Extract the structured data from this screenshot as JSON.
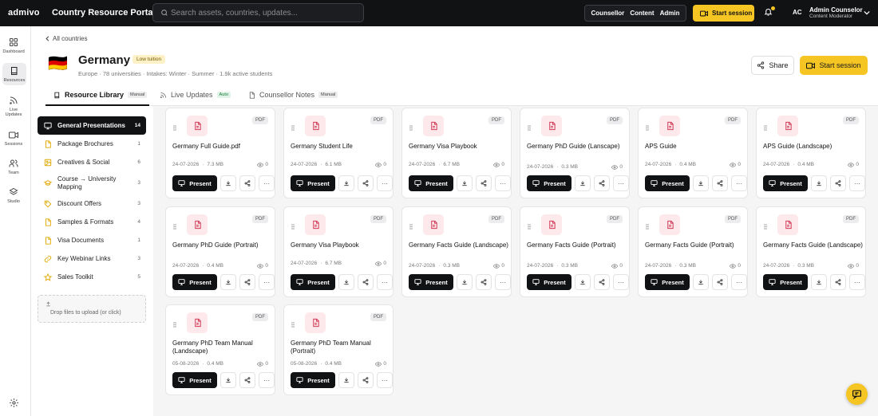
{
  "app": {
    "brand": "admivo",
    "title": "Country Resource Portal"
  },
  "search": {
    "placeholder": "Search assets, countries, updates..."
  },
  "roles": [
    "Counsellor",
    "Content",
    "Admin"
  ],
  "header": {
    "start_session": "Start session"
  },
  "user": {
    "initials": "AC",
    "name": "Admin Counselor",
    "role": "Content Moderator"
  },
  "rail": [
    {
      "label": "Dashboard",
      "icon": "grid-icon"
    },
    {
      "label": "Resources",
      "icon": "book-icon"
    },
    {
      "label": "Live Updates",
      "icon": "rss-icon"
    },
    {
      "label": "Sessions",
      "icon": "video-icon"
    },
    {
      "label": "Team",
      "icon": "users-icon"
    },
    {
      "label": "Studio",
      "icon": "layers-icon"
    }
  ],
  "page": {
    "back": "All countries",
    "flag": "🇩🇪",
    "country": "Germany",
    "badge": "Low tuition",
    "meta": "Europe · 78 universities · Intakes: Winter · Summer · 1.9k active students",
    "share": "Share",
    "start_session": "Start session"
  },
  "tabs": [
    {
      "label": "Resource Library",
      "badge": "Manual"
    },
    {
      "label": "Live Updates",
      "badge": "Auto"
    },
    {
      "label": "Counsellor Notes",
      "badge": "Manual"
    }
  ],
  "categories": [
    {
      "label": "General Presentations",
      "count": "14"
    },
    {
      "label": "Package Brochures",
      "count": "1"
    },
    {
      "label": "Creatives & Social",
      "count": "6"
    },
    {
      "label": "Course → University Mapping",
      "count": "3"
    },
    {
      "label": "Discount Offers",
      "count": "3"
    },
    {
      "label": "Samples & Formats",
      "count": "4"
    },
    {
      "label": "Visa Documents",
      "count": "1"
    },
    {
      "label": "Key Webinar Links",
      "count": "3"
    },
    {
      "label": "Sales Toolkit",
      "count": "5"
    }
  ],
  "upload": {
    "label": "Drop files to upload (or click)"
  },
  "card_labels": {
    "type": "PDF",
    "present": "Present",
    "more": "···"
  },
  "resources": [
    {
      "name": "Germany Full Guide.pdf",
      "date": "24-07-2026",
      "size": "7.3 MB",
      "views": "0"
    },
    {
      "name": "Germany Student Life",
      "date": "24-07-2026",
      "size": "6.1 MB",
      "views": "0"
    },
    {
      "name": "Germany Visa Playbook",
      "date": "24-07-2026",
      "size": "6.7 MB",
      "views": "0"
    },
    {
      "name": "Germany PhD Guide (Lanscape)",
      "date": "24-07-2026",
      "size": "0.3 MB",
      "views": "0"
    },
    {
      "name": "APS Guide",
      "date": "24-07-2026",
      "size": "0.4 MB",
      "views": "0"
    },
    {
      "name": "APS Guide (Landscape)",
      "date": "24-07-2026",
      "size": "0.4 MB",
      "views": "0"
    },
    {
      "name": "Germany PhD Guide (Portrait)",
      "date": "24-07-2026",
      "size": "0.4 MB",
      "views": "0"
    },
    {
      "name": "Germany Visa Playbook",
      "date": "24-07-2026",
      "size": "6.7 MB",
      "views": "0"
    },
    {
      "name": "Germany Facts Guide (Landscape)",
      "date": "24-07-2026",
      "size": "0.3 MB",
      "views": "0"
    },
    {
      "name": "Germany Facts Guide (Portrait)",
      "date": "24-07-2026",
      "size": "0.3 MB",
      "views": "0"
    },
    {
      "name": "Germany Facts Guide (Portrait)",
      "date": "24-07-2026",
      "size": "0.3 MB",
      "views": "0"
    },
    {
      "name": "Germany Facts Guide (Landscape)",
      "date": "24-07-2026",
      "size": "0.3 MB",
      "views": "0"
    },
    {
      "name": "Germany PhD Team Manual (Landscape)",
      "date": "05-08-2026",
      "size": "0.4 MB",
      "views": "0"
    },
    {
      "name": "Germany PhD Team Manual (Portrait)",
      "date": "05-08-2026",
      "size": "0.4 MB",
      "views": "0"
    }
  ],
  "colors": {
    "accent": "#f5c523",
    "dark": "#111214",
    "pdf_bg": "#fde8ec",
    "pdf_icon": "#d23a55"
  }
}
